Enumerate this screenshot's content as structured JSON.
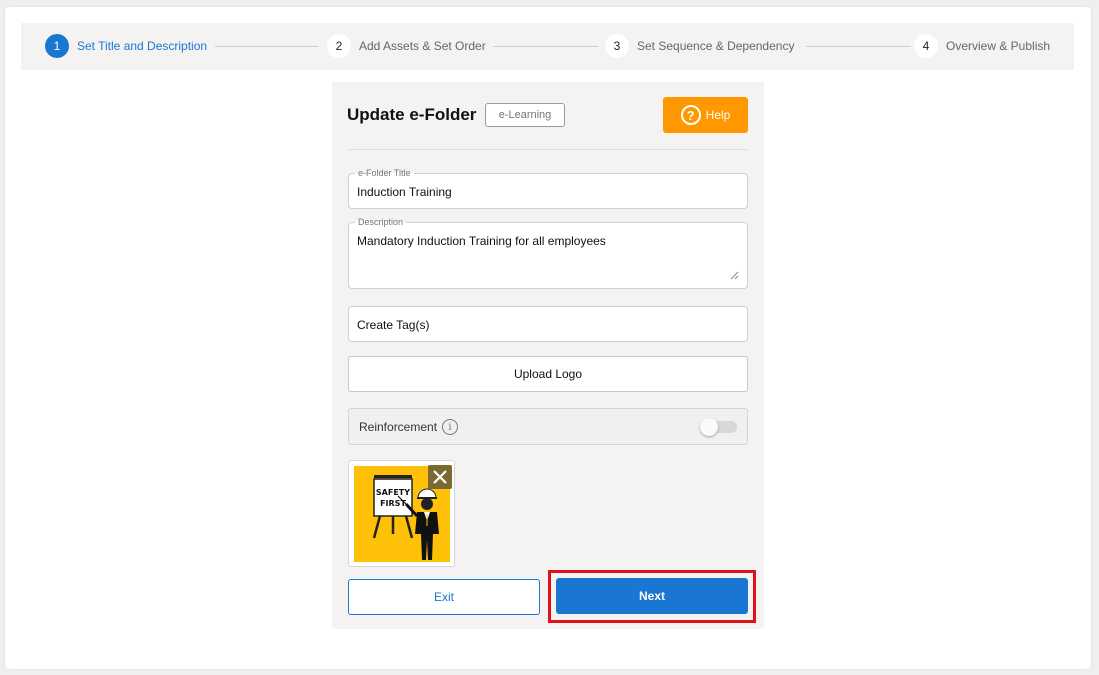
{
  "stepper": {
    "steps": [
      {
        "number": "1",
        "label": "Set Title and Description",
        "state": "active"
      },
      {
        "number": "2",
        "label": "Add Assets & Set Order",
        "state": "inactive"
      },
      {
        "number": "3",
        "label": "Set Sequence & Dependency",
        "state": "inactive"
      },
      {
        "number": "4",
        "label": "Overview & Publish",
        "state": "inactive"
      }
    ]
  },
  "card": {
    "title": "Update e-Folder",
    "badge": "e-Learning",
    "help_label": "Help",
    "help_icon": "question-circle-icon",
    "title_field": {
      "label": "e-Folder Title",
      "value": "Induction Training"
    },
    "description_field": {
      "label": "Description",
      "value": "Mandatory Induction Training for all employees"
    },
    "tags_field": {
      "placeholder": "Create Tag(s)"
    },
    "upload_logo_label": "Upload Logo",
    "reinforcement": {
      "label": "Reinforcement",
      "info_icon": "info-icon",
      "enabled": false
    },
    "logo": {
      "sign_text": [
        "SAFETY",
        "FIRST"
      ],
      "background_color": "#ffc107",
      "remove_icon": "close-icon"
    },
    "exit_label": "Exit",
    "next_label": "Next"
  },
  "colors": {
    "primary": "#1976d2",
    "help": "#ff9800",
    "highlight": "#e0111b"
  }
}
